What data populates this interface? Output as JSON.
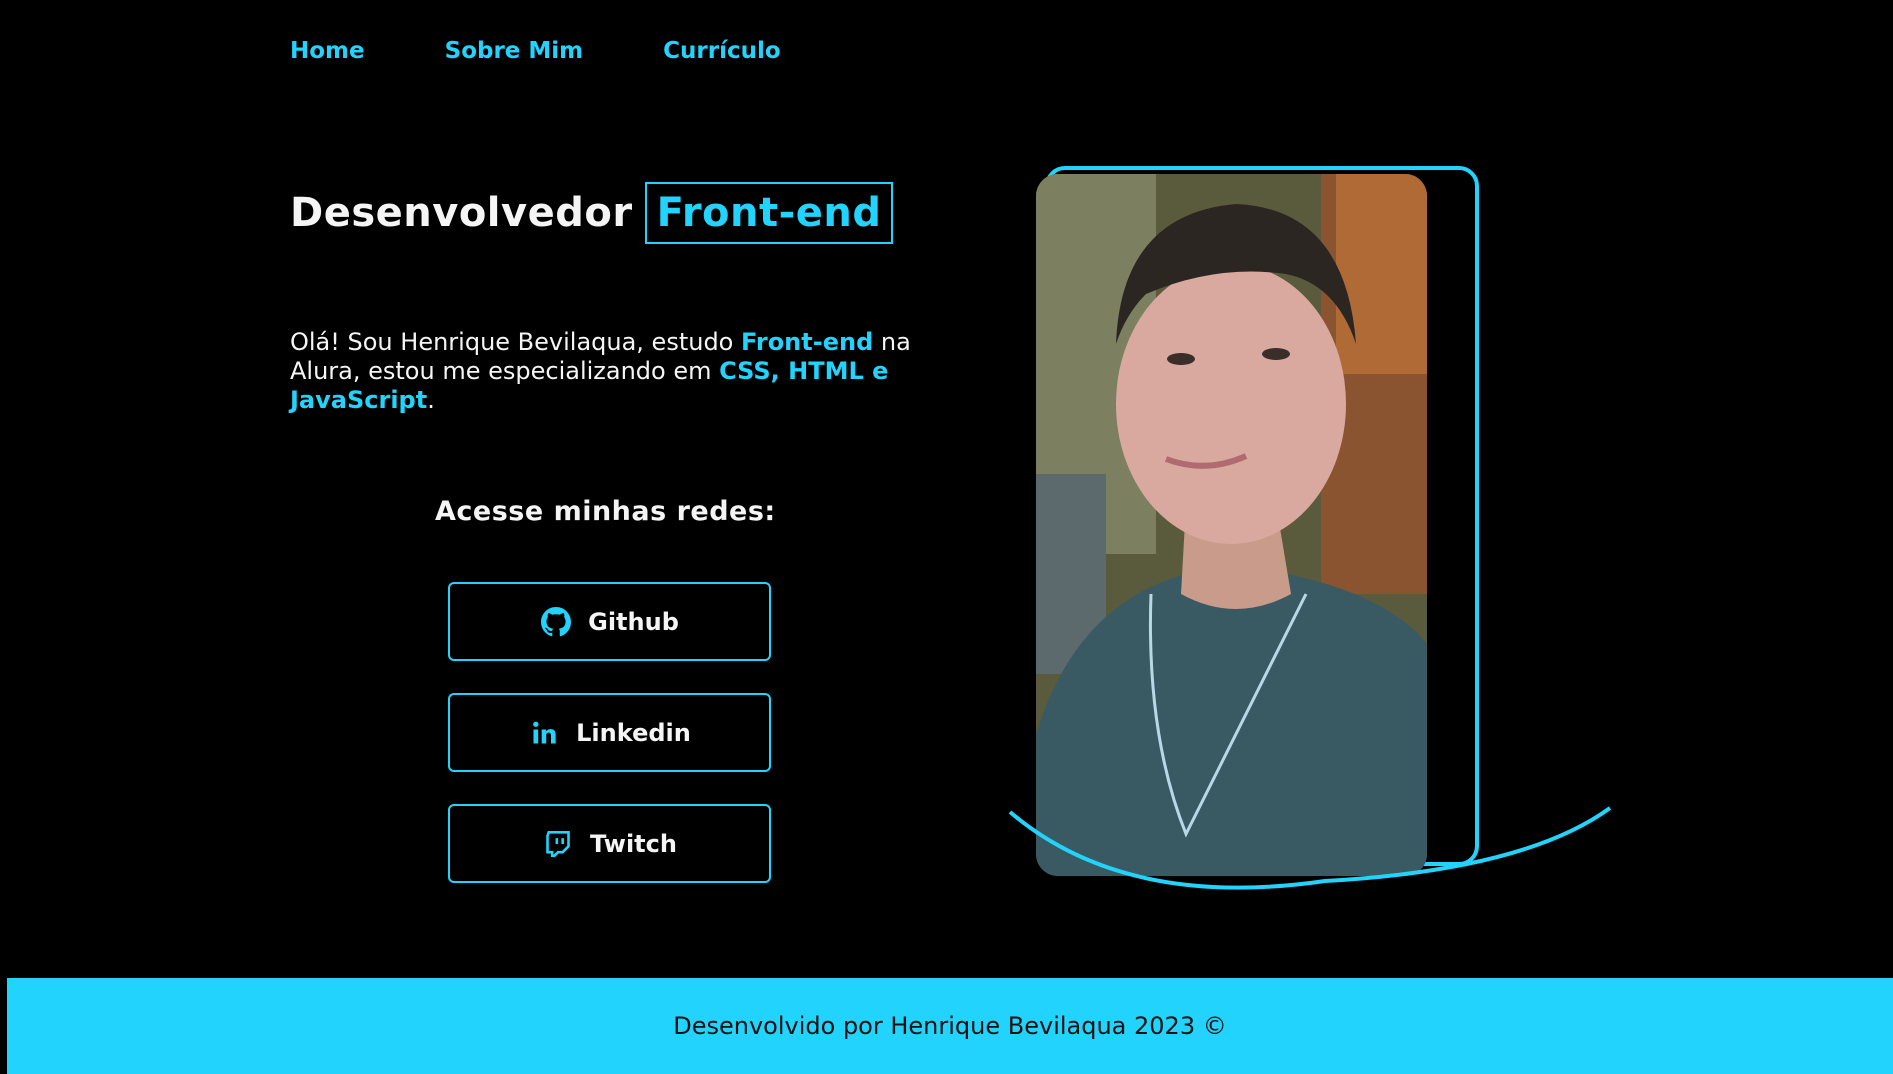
{
  "nav": {
    "items": [
      {
        "label": "Home"
      },
      {
        "label": "Sobre Mim"
      },
      {
        "label": "Currículo"
      }
    ]
  },
  "hero": {
    "title_prefix": "Desenvolvedor",
    "title_accent": "Front-end",
    "intro": {
      "part1": "Olá! Sou Henrique Bevilaqua, estudo ",
      "hl1": "Front-end",
      "part2": " na Alura, estou me especializando em ",
      "hl2": "CSS, HTML e JavaScript",
      "part3": "."
    }
  },
  "social": {
    "title": "Acesse minhas redes:",
    "buttons": [
      {
        "label": "Github",
        "icon": "github-icon"
      },
      {
        "label": "Linkedin",
        "icon": "linkedin-icon"
      },
      {
        "label": "Twitch",
        "icon": "twitch-icon"
      }
    ]
  },
  "footer": {
    "text": "Desenvolvido por Henrique Bevilaqua 2023 ©"
  },
  "colors": {
    "accent": "#22d4fd",
    "background": "#000000",
    "text": "#f5f5f5"
  }
}
